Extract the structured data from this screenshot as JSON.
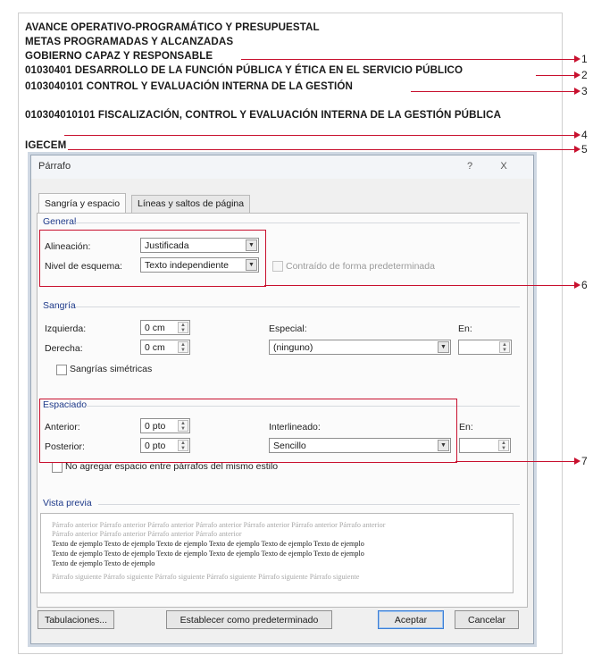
{
  "document": {
    "lines": [
      "AVANCE OPERATIVO-PROGRAMÁTICO Y PRESUPUESTAL",
      "METAS PROGRAMADAS Y ALCANZADAS",
      "GOBIERNO CAPAZ Y RESPONSABLE",
      "01030401 DESARROLLO DE LA FUNCIÓN PÚBLICA Y ÉTICA EN EL SERVICIO PÚBLICO",
      "0103040101 CONTROL Y EVALUACIÓN INTERNA DE LA GESTIÓN",
      "010304010101 FISCALIZACIÓN, CONTROL Y EVALUACIÓN INTERNA DE LA GESTIÓN PÚBLICA",
      "IGECEM"
    ]
  },
  "callouts": [
    "1",
    "2",
    "3",
    "4",
    "5",
    "6",
    "7"
  ],
  "dialog": {
    "title": "Párrafo",
    "help_label": "?",
    "close_label": "X",
    "tabs": [
      "Sangría y espacio",
      "Líneas y saltos de página"
    ],
    "general": {
      "section": "General",
      "alignment_label": "Alineación:",
      "alignment_value": "Justificada",
      "outline_label": "Nivel de esquema:",
      "outline_value": "Texto independiente",
      "collapsed_label": "Contraído de forma predeterminada"
    },
    "indent": {
      "section": "Sangría",
      "left_label": "Izquierda:",
      "left_value": "0 cm",
      "right_label": "Derecha:",
      "right_value": "0 cm",
      "special_label": "Especial:",
      "special_value": "(ninguno)",
      "by_label": "En:",
      "mirror_label": "Sangrías simétricas"
    },
    "spacing": {
      "section": "Espaciado",
      "before_label": "Anterior:",
      "before_value": "0 pto",
      "after_label": "Posterior:",
      "after_value": "0 pto",
      "line_label": "Interlineado:",
      "line_value": "Sencillo",
      "at_label": "En:",
      "no_space_label": "No agregar espacio entre párrafos del mismo estilo"
    },
    "preview": {
      "section": "Vista previa",
      "prev_1": "Párrafo anterior Párrafo anterior Párrafo anterior Párrafo anterior Párrafo anterior Párrafo anterior Párrafo anterior",
      "prev_2": "Párrafo anterior Párrafo anterior Párrafo anterior Párrafo anterior",
      "sample_1": "Texto de ejemplo Texto de ejemplo Texto de ejemplo Texto de ejemplo Texto de ejemplo Texto de ejemplo",
      "sample_2": "Texto de ejemplo Texto de ejemplo Texto de ejemplo Texto de ejemplo Texto de ejemplo Texto de ejemplo",
      "sample_3": "Texto de ejemplo Texto de ejemplo",
      "next_1": "Párrafo siguiente Párrafo siguiente Párrafo siguiente Párrafo siguiente Párrafo siguiente Párrafo siguiente"
    },
    "buttons": {
      "tabs": "Tabulaciones...",
      "default": "Establecer como predeterminado",
      "ok": "Aceptar",
      "cancel": "Cancelar"
    }
  },
  "colors": {
    "callout": "#c8102e",
    "section_heading": "#1e3a8a"
  }
}
